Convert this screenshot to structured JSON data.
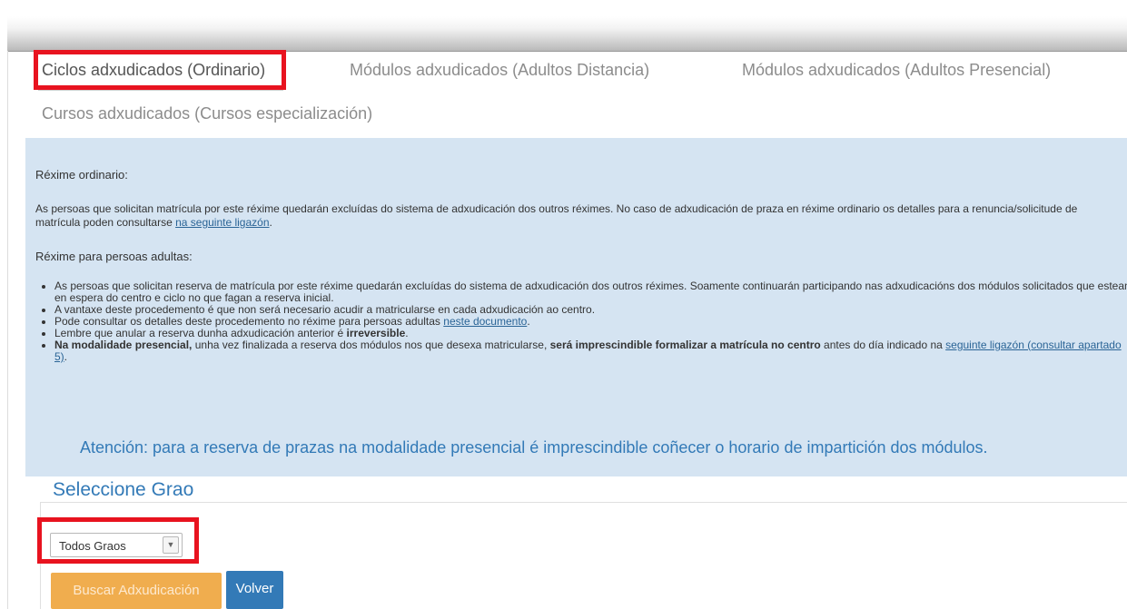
{
  "tabs": {
    "ordinario": "Ciclos adxudicados (Ordinario)",
    "adultos_distancia": "Módulos adxudicados (Adultos Distancia)",
    "adultos_presencial": "Módulos adxudicados (Adultos Presencial)",
    "cursos_especializacion": "Cursos adxudicados (Cursos especialización)"
  },
  "info": {
    "heading_ordinario": "Réxime ordinario:",
    "ordinario_text_1": "As persoas que solicitan matrícula por este réxime quedarán excluídas do sistema de adxudicación dos outros réximes. No caso de adxudicación de praza en réxime ordinario os detalles para a renuncia/solicitude de matrícula poden consultarse ",
    "ordinario_link": "na seguinte ligazón",
    "ordinario_text_2": ".",
    "heading_adultas": "Réxime para persoas adultas:",
    "bullet_1": "As persoas que solicitan reserva de matrícula por este réxime quedarán excluídas do sistema de adxudicación dos outros réximes. Soamente continuarán participando nas adxudicacións dos módulos solicitados que estean en espera do centro e ciclo no que fagan a reserva inicial.",
    "bullet_2": "A vantaxe deste procedemento é que non será necesario acudir a matricularse en cada adxudicación ao centro.",
    "bullet_3_text": "Pode consultar os detalles deste procedemento no réxime para persoas adultas ",
    "bullet_3_link": "neste documento",
    "bullet_3_end": ".",
    "bullet_4_text": "Lembre que anular a reserva dunha adxudicación anterior é ",
    "bullet_4_bold": "irreversible",
    "bullet_4_end": ".",
    "bullet_5_bold_1": "Na modalidade presencial,",
    "bullet_5_text_1": " unha vez finalizada a reserva dos módulos nos que desexa matricularse, ",
    "bullet_5_bold_2": "será imprescindible formalizar a matrícula no centro",
    "bullet_5_text_2": " antes do día indicado na ",
    "bullet_5_link": "seguinte ligazón (consultar apartado 5)",
    "bullet_5_end": ".",
    "attention": "Atención: para a reserva de prazas na modalidade presencial é imprescindible coñecer o horario de impartición dos módulos."
  },
  "form": {
    "legend": "Seleccione Grao",
    "grao_select_value": "Todos Graos",
    "search_button": "Buscar Adxudicación",
    "back_button": "Volver"
  },
  "colors": {
    "highlight": "#e8131f",
    "info_background": "#d5e4f2",
    "accent_blue": "#337ab7",
    "search_button": "#f0ad4e"
  },
  "icons": {
    "select_arrow": "chevron-down-icon"
  }
}
